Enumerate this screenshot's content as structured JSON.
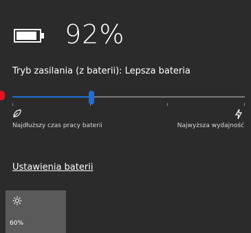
{
  "battery": {
    "percent_text": "92%",
    "level": 0.92
  },
  "power_mode": {
    "label": "Tryb zasilania (z baterii): Lepsza bateria",
    "slider_value": 0.34,
    "left_label": "Najdłuższy czas pracy baterii",
    "right_label": "Najwyższa wydajność",
    "left_icon": "leaf-icon",
    "right_icon": "lightning-bolt-icon"
  },
  "links": {
    "battery_settings": "Ustawienia baterii"
  },
  "brightness_tile": {
    "icon": "brightness-sun-icon",
    "value_text": "60%"
  },
  "colors": {
    "accent": "#1d6fd9",
    "indicator": "#e81123",
    "background": "#2b2b2b",
    "tile": "#5a5a5a"
  }
}
